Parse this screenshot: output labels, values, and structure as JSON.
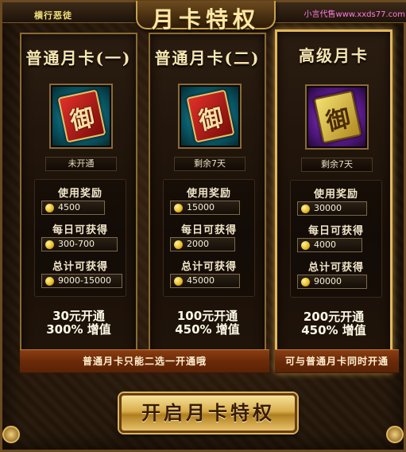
{
  "header": {
    "left_text": "横行恶徒",
    "watermark": "小言代售www.xxds77.com",
    "title": "月卡特权"
  },
  "cards": [
    {
      "title": "普通月卡(一)",
      "status": "未开通",
      "icon": "red-card-icon",
      "reward_label": "使用奖励",
      "reward_value": "4500",
      "daily_label": "每日可获得",
      "daily_value": "300-700",
      "total_label": "总计可获得",
      "total_value": "9000-15000",
      "price": "30元开通",
      "bonus": "300% 增值"
    },
    {
      "title": "普通月卡(二)",
      "status": "剩余7天",
      "icon": "red-card-icon",
      "reward_label": "使用奖励",
      "reward_value": "15000",
      "daily_label": "每日可获得",
      "daily_value": "2000",
      "total_label": "总计可获得",
      "total_value": "45000",
      "price": "100元开通",
      "bonus": "450% 增值"
    },
    {
      "title": "高级月卡",
      "status": "剩余7天",
      "icon": "gold-card-icon",
      "reward_label": "使用奖励",
      "reward_value": "30000",
      "daily_label": "每日可获得",
      "daily_value": "4000",
      "total_label": "总计可获得",
      "total_value": "90000",
      "price": "200元开通",
      "bonus": "450% 增值"
    }
  ],
  "banners": {
    "normal": "普通月卡只能二选一开通哦",
    "premium": "可与普通月卡同时开通"
  },
  "open_button": "开启月卡特权",
  "colors": {
    "gold_accent": "#e2b75b",
    "banner_red": "#6a2a08",
    "button_gold": "#d8ad4a"
  }
}
